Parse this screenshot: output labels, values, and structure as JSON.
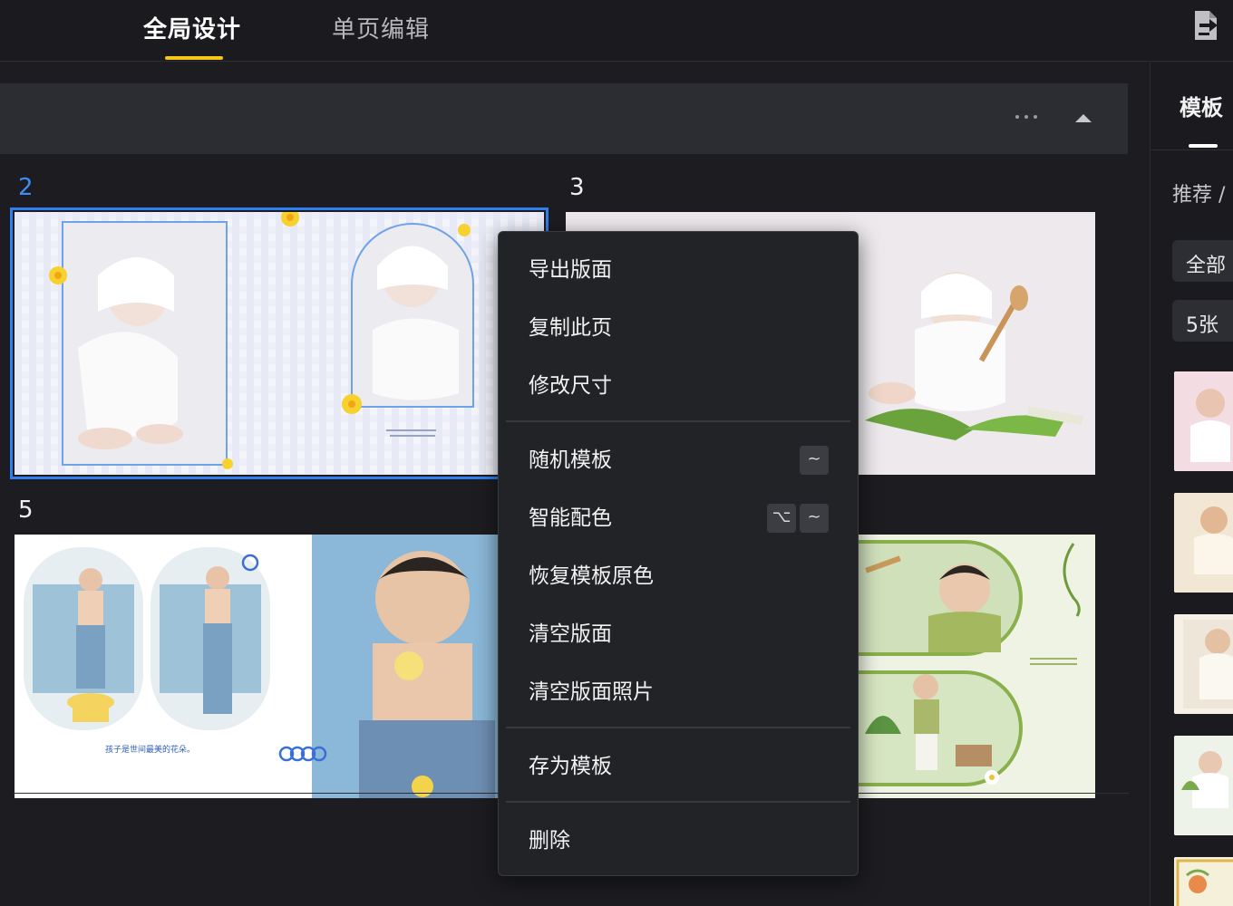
{
  "tabs": [
    {
      "label": "全局设计",
      "active": true
    },
    {
      "label": "单页编辑",
      "active": false
    }
  ],
  "header": {
    "export_icon": "export-icon"
  },
  "section": {
    "more_icon": "more-icon",
    "collapse_icon": "collapse-up-icon"
  },
  "pages": [
    {
      "number": "2",
      "selected": true,
      "caption": ""
    },
    {
      "number": "3",
      "selected": false,
      "caption": ""
    },
    {
      "number": "5",
      "selected": false,
      "caption": "孩子是世间最美的花朵。"
    },
    {
      "number": "",
      "selected": false,
      "caption": ""
    }
  ],
  "context_menu": {
    "items": [
      {
        "label": "导出版面"
      },
      {
        "label": "复制此页"
      },
      {
        "label": "修改尺寸"
      },
      {
        "label": "随机模板",
        "shortcut": [
          "~"
        ]
      },
      {
        "label": "智能配色",
        "shortcut": [
          "⌥",
          "~"
        ]
      },
      {
        "label": "恢复模板原色"
      },
      {
        "label": "清空版面"
      },
      {
        "label": "清空版面照片"
      },
      {
        "label": "存为模板"
      },
      {
        "label": "删除"
      }
    ]
  },
  "right_panel": {
    "tab": "模板",
    "breadcrumb": "推荐 /",
    "filter_all": "全部",
    "filter_count": "5张"
  },
  "colors": {
    "accent_yellow": "#f5c518",
    "selected_blue": "#2f7ff0",
    "bg": "#1d1d21",
    "menu_bg": "#222327"
  }
}
